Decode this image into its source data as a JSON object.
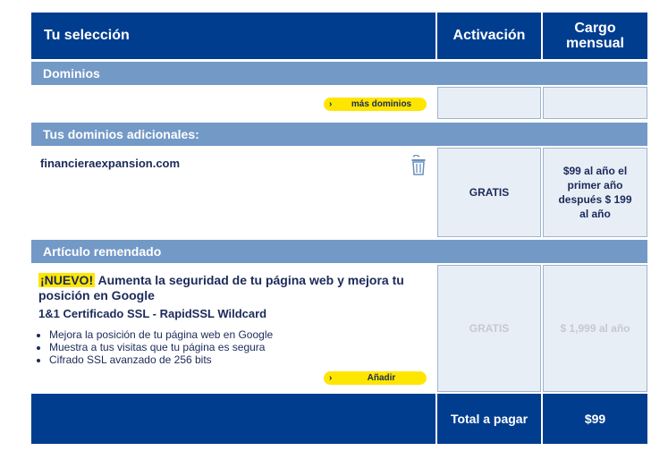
{
  "header": {
    "col_selection": "Tu selección",
    "col_activation": "Activación",
    "col_monthly": "Cargo mensual"
  },
  "domains_section": {
    "title": "Dominios",
    "more_button": "más dominios"
  },
  "additional_section": {
    "title": "Tus dominios adicionales:",
    "domain_name": "financieraexpansion.com",
    "activation": "GRATIS",
    "price": "$99 al año  el primer año después $ 199 al año"
  },
  "recommended_section": {
    "title": "Artículo remendado",
    "badge": "¡NUEVO!",
    "headline": " Aumenta la seguridad de tu página web y mejora tu posición en Google",
    "product": "1&1 Certificado SSL - RapidSSL Wildcard",
    "bullets": [
      "Mejora la posición de tu página web en Google",
      "Muestra a tus visitas que tu página es segura",
      "Cifrado SSL avanzado de 256 bits"
    ],
    "add_button": "Añadir",
    "activation": "GRATIS",
    "price": "$ 1,999 al año"
  },
  "footer": {
    "total_label": "Total a pagar",
    "total_value": "$99"
  },
  "colors": {
    "header_blue": "#003d8f",
    "section_blue": "#7399c6",
    "light_cell": "#e8eef6",
    "button_yellow": "#ffe600"
  },
  "icons": {
    "trash": "trash-icon",
    "chevron": "chevron-right-icon"
  }
}
